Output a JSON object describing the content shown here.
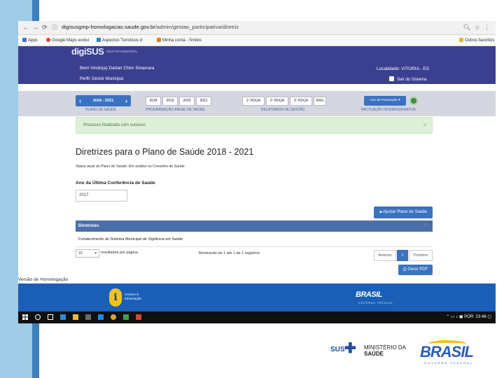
{
  "browser": {
    "url_host": "digisusgmp-homologacao.saude.gov.br",
    "url_path": "/admin/gestao_participativa/diretriz",
    "bookmarks": [
      {
        "label": "Apps",
        "color": "#4a6fd0"
      },
      {
        "label": "Google Maps evolui",
        "color": "#db4437"
      },
      {
        "label": "Aspectos Turísticos d",
        "color": "#2f7fd0"
      },
      {
        "label": "Minha conta - Smiles",
        "color": "#f27a1a"
      }
    ],
    "other_bookmarks": "Outros favoritos"
  },
  "header": {
    "logo": "digiSUS",
    "logo_sub": "GESTOR MUNICIPAL",
    "welcome": "Bem Vindo(a) Darlan Chim Smarrara",
    "profile": "Perfil: Gestor Municipal",
    "locality": "Localidade: VITORIA - ES",
    "logout": "Sair do Sistema"
  },
  "menu": {
    "plan_range": "2018 - 2021",
    "plan_label": "PLANO DE SAÚDE",
    "years": [
      "2018",
      "2019",
      "2020",
      "2021"
    ],
    "years_label": "PROGRAMAÇÃO ANUAL DE SAÚDE",
    "reports": [
      "1º RDQA",
      "2º RDQA",
      "3º RDQA",
      "RAG"
    ],
    "reports_label": "RELATÓRIOS DE GESTÃO",
    "pact_button": "Ano de Pactuação",
    "pact_label": "PACTUAÇÃO INTERFEDERATIVA"
  },
  "alert": {
    "text": "Processo finalizado com sucesso",
    "close": "×"
  },
  "main": {
    "title": "Diretrizes para o Plano de Saúde 2018 - 2021",
    "status": "Status atual do Plano de Saúde: Em análise no Conselho de Saúde",
    "conference_label": "Ano da Última Conferência de Saúde",
    "conference_value": "2017",
    "adjust_button": "Ajustar Plano de Saúde",
    "table_header": "Diretrizes",
    "sort_icon": "↓↑",
    "rows": [
      "Fortalecimento do Sistema Municipal de Vigilância em Saúde"
    ],
    "page_length": "10",
    "page_length_label": "resultados por página",
    "info": "Mostrando de 1 até 1 de 1 registros",
    "prev": "Anterior",
    "page": "1",
    "next": "Próximo",
    "pdf_button": "Gerar PDF"
  },
  "version": "Versão de Homologação",
  "footer": {
    "access_line1": "Acesso à",
    "access_line2": "Informação",
    "brasil": "BRASIL",
    "brasil_sub": "GOVERNO FEDERAL"
  },
  "taskbar": {
    "lang": "POR",
    "time": "23:46"
  },
  "slide_logos": {
    "sus": "SUS",
    "ministerio_line1": "MINISTÉRIO DA",
    "ministerio_line2": "SAÚDE",
    "brasil": "BRASIL",
    "brasil_sub": "GOVERNO FEDERAL"
  },
  "colors": {
    "header_bg": "#3b3f8f",
    "accent_blue": "#3b72c0",
    "footer_bg": "#1a5fb5",
    "success_bg": "#dff0d8"
  }
}
